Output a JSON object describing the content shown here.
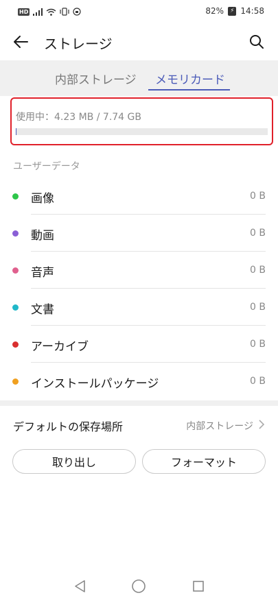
{
  "status": {
    "left_icons": [
      "hd-icon",
      "signal-icon",
      "wifi-icon",
      "vibrate-icon",
      "alarm-icon"
    ],
    "hd": "HD",
    "battery_percent": "82%",
    "time": "14:58"
  },
  "header": {
    "title": "ストレージ",
    "back_icon": "back-arrow-icon",
    "search_icon": "search-icon"
  },
  "tabs": [
    {
      "label": "内部ストレージ",
      "active": false
    },
    {
      "label": "メモリカード",
      "active": true
    }
  ],
  "usage": {
    "text": "使用中：4.23 MB / 7.74 GB",
    "fraction": 0.0005
  },
  "section_label": "ユーザーデータ",
  "items": [
    {
      "label": "画像",
      "size": "0 B",
      "color": "#2ec64a"
    },
    {
      "label": "動画",
      "size": "0 B",
      "color": "#8a5fd6"
    },
    {
      "label": "音声",
      "size": "0 B",
      "color": "#e0608e"
    },
    {
      "label": "文書",
      "size": "0 B",
      "color": "#20b8c9"
    },
    {
      "label": "アーカイブ",
      "size": "0 B",
      "color": "#d93030"
    },
    {
      "label": "インストールパッケージ",
      "size": "0 B",
      "color": "#f0a020"
    }
  ],
  "default_location": {
    "label": "デフォルトの保存場所",
    "value": "内部ストレージ"
  },
  "buttons": {
    "eject": "取り出し",
    "format": "フォーマット"
  },
  "colors": {
    "accent": "#4b5bb8",
    "highlight_border": "#e0202a"
  }
}
